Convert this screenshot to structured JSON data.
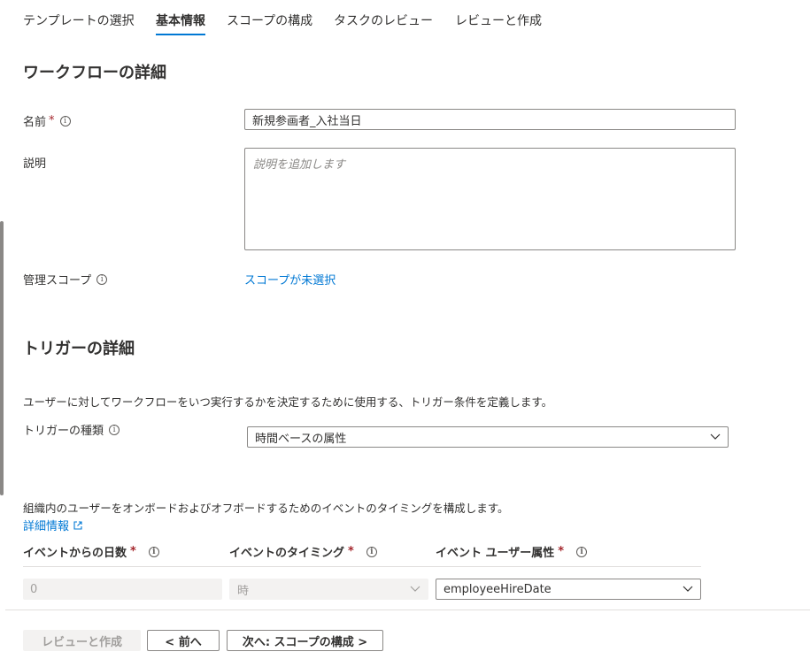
{
  "tabs": [
    {
      "label": "テンプレートの選択"
    },
    {
      "label": "基本情報"
    },
    {
      "label": "スコープの構成"
    },
    {
      "label": "タスクのレビュー"
    },
    {
      "label": "レビューと作成"
    }
  ],
  "workflow_details": {
    "title": "ワークフローの詳細",
    "name_label": "名前",
    "name_value": "新規参画者_入社当日",
    "description_label": "説明",
    "description_placeholder": "説明を追加します",
    "admin_scope_label": "管理スコープ",
    "admin_scope_link": "スコープが未選択"
  },
  "trigger_details": {
    "title": "トリガーの詳細",
    "description": "ユーザーに対してワークフローをいつ実行するかを決定するために使用する、トリガー条件を定義します。",
    "trigger_type_label": "トリガーの種類",
    "trigger_type_value": "時間ベースの属性",
    "timing_description": "組織内のユーザーをオンボードおよびオフボードするためのイベントのタイミングを構成します。",
    "learn_more_link": "詳細情報",
    "columns": {
      "days_from_event": "イベントからの日数",
      "event_timing": "イベントのタイミング",
      "event_user_attribute": "イベント ユーザー属性"
    },
    "days_value": "0",
    "timing_value": "時",
    "attribute_value": "employeeHireDate"
  },
  "footer": {
    "review_create": "レビューと作成",
    "previous": "< 前へ",
    "next": "次へ: スコープの構成 >"
  },
  "colors": {
    "accent": "#0078d4",
    "required": "#a4262c",
    "disabled_bg": "#f3f2f1"
  }
}
